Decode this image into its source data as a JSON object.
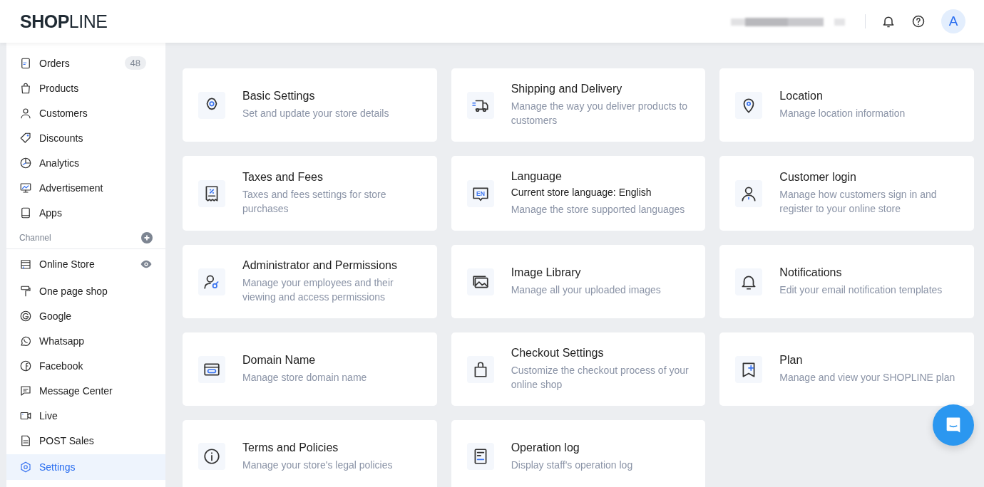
{
  "header": {
    "logo": "**SHOP**LINE",
    "avatar": "A"
  },
  "sidebar": {
    "items": [
      {
        "label": "Orders",
        "badge": "48",
        "selected": false
      },
      {
        "label": "Products",
        "selected": false
      },
      {
        "label": "Customers",
        "selected": false
      },
      {
        "label": "Discounts",
        "selected": false
      },
      {
        "label": "Analytics",
        "selected": false
      },
      {
        "label": "Advertisement",
        "selected": false
      },
      {
        "label": "Apps",
        "selected": false
      }
    ],
    "channel_label": "Channel",
    "channels": [
      {
        "label": "Online Store",
        "selected": false
      },
      {
        "label": "One page shop",
        "selected": false
      },
      {
        "label": "Google",
        "selected": false
      },
      {
        "label": "Whatsapp",
        "selected": false
      },
      {
        "label": "Facebook",
        "selected": false
      },
      {
        "label": "Message Center",
        "selected": false
      },
      {
        "label": "Live",
        "selected": false
      },
      {
        "label": "POST Sales",
        "selected": false
      }
    ],
    "settings_item": {
      "label": "Settings",
      "selected": true
    }
  },
  "cards": [
    {
      "title": "Basic Settings",
      "description": "Set and update your store details"
    },
    {
      "title": "Shipping and Delivery",
      "description": "Manage the way you deliver products to customers"
    },
    {
      "title": "Location",
      "description": "Manage location information"
    },
    {
      "title": "Taxes and Fees",
      "description": "Taxes and fees settings for store purchases"
    },
    {
      "title": "Language",
      "current": "Current store language: English",
      "description": "Manage the store supported languages",
      "icon_label": "EN"
    },
    {
      "title": "Customer login",
      "description": "Manage how customers sign in and register to your online store"
    },
    {
      "title": "Administrator and Permissions",
      "description": "Manage your employees and their viewing and access permissions"
    },
    {
      "title": "Image Library",
      "description": "Manage all your uploaded images"
    },
    {
      "title": "Notifications",
      "description": "Edit your email notification templates"
    },
    {
      "title": "Domain Name",
      "description": "Manage store domain name"
    },
    {
      "title": "Checkout Settings",
      "description": "Customize the checkout process of your online shop"
    },
    {
      "title": "Plan",
      "description": "Manage and view your SHOPLINE plan"
    },
    {
      "title": "Terms and Policies",
      "description": "Manage your store's legal policies"
    },
    {
      "title": "Operation log",
      "description": "Display staff's operation log"
    }
  ]
}
